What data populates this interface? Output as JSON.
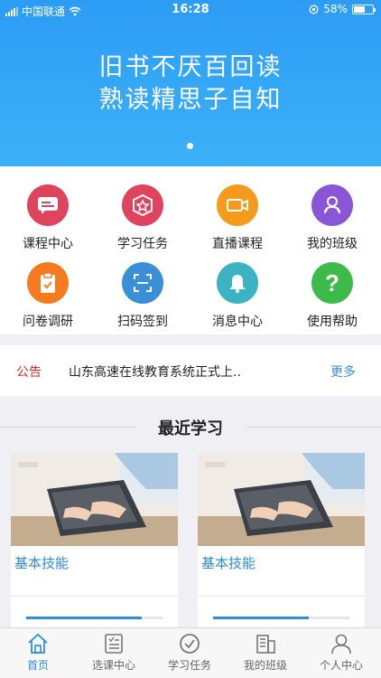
{
  "status_bar": {
    "carrier": "中国联通",
    "time": "16:28",
    "battery": "58%"
  },
  "banner": {
    "line1": "旧书不厌百回读",
    "line2": "熟读精思子自知"
  },
  "grid": [
    {
      "label": "课程中心",
      "icon": "chat-card-icon",
      "color": "#e0435d"
    },
    {
      "label": "学习任务",
      "icon": "badge-star-icon",
      "color": "#e0435d"
    },
    {
      "label": "直播课程",
      "icon": "video-camera-icon",
      "color": "#f59a1b"
    },
    {
      "label": "我的班级",
      "icon": "group-icon",
      "color": "#8a56d8"
    },
    {
      "label": "问卷调研",
      "icon": "clipboard-check-icon",
      "color": "#f57a20"
    },
    {
      "label": "扫码签到",
      "icon": "scan-icon",
      "color": "#3a8fd6"
    },
    {
      "label": "消息中心",
      "icon": "bell-icon",
      "color": "#3bb3c3"
    },
    {
      "label": "使用帮助",
      "icon": "question-icon",
      "color": "#3dbb4a"
    }
  ],
  "notice": {
    "tag": "公告",
    "text": "山东高速在线教育系统正式上..",
    "more": "更多"
  },
  "recent": {
    "title": "最近学习",
    "courses": [
      {
        "title": "基本技能",
        "progress": 0.85
      },
      {
        "title": "基本技能",
        "progress": 0.7
      }
    ]
  },
  "tabbar": {
    "active": 0,
    "tabs": [
      {
        "label": "首页",
        "icon": "home-icon"
      },
      {
        "label": "选课中心",
        "icon": "course-select-icon"
      },
      {
        "label": "学习任务",
        "icon": "check-circle-icon"
      },
      {
        "label": "我的班级",
        "icon": "building-icon"
      },
      {
        "label": "个人中心",
        "icon": "person-icon"
      }
    ]
  },
  "colors": {
    "primary": "#2f8fd8",
    "banner": "#2c9cf5",
    "notice_tag": "#d32a2a"
  }
}
